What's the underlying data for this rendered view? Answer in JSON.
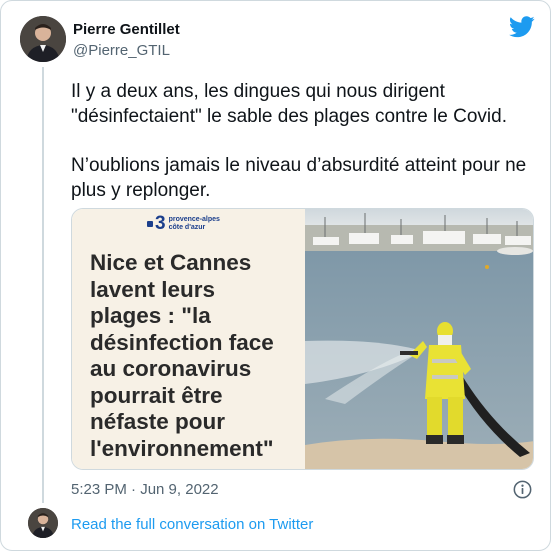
{
  "author": {
    "name": "Pierre Gentillet",
    "handle": "@Pierre_GTIL"
  },
  "tweet": {
    "paragraphs": [
      "Il y a deux ans, les dingues qui nous dirigent \"désinfectaient\" le sable des plages contre le Covid.",
      "N’oublions jamais le niveau d’absurdité atteint pour ne plus y replonger."
    ],
    "timestamp": "5:23 PM · Jun 9, 2022"
  },
  "media": {
    "logo_number": "3",
    "logo_region_line1": "provence-alpes",
    "logo_region_line2": "côte d'azur",
    "headline_lines": [
      "Nice et Cannes",
      "lavent leurs",
      "plages : \"la",
      "désinfection face",
      "au coronavirus",
      "pourrait être",
      "néfaste pour",
      "l'environnement\""
    ]
  },
  "footer": {
    "read_link": "Read the full conversation on Twitter"
  },
  "icons": {
    "brand": "twitter-bird-icon",
    "info": "info-icon"
  },
  "colors": {
    "accent": "#1d9bf0",
    "secondary_text": "#536471",
    "border": "#cfd9de",
    "logo_blue": "#1c3f8c"
  }
}
